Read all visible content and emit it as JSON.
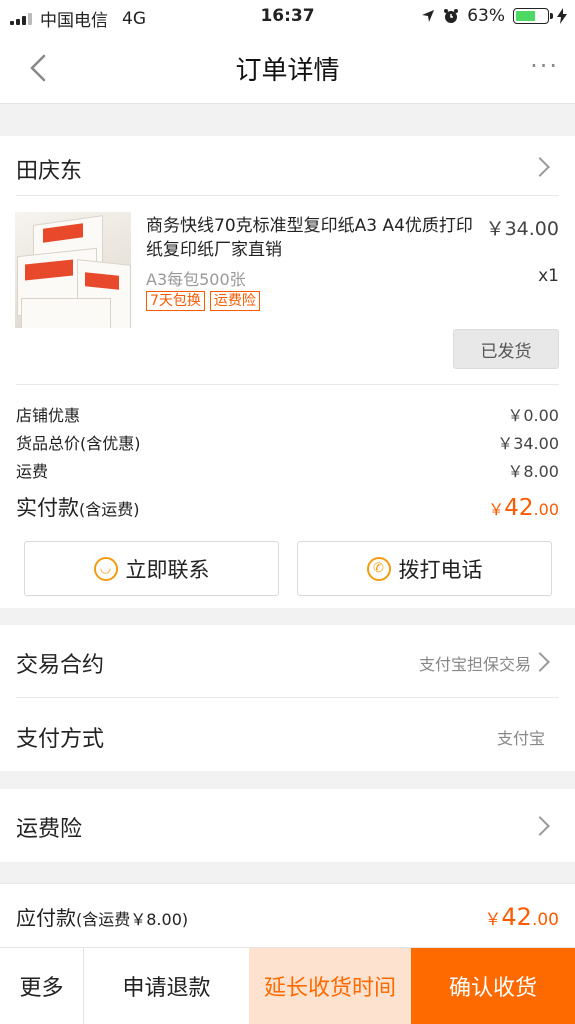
{
  "status_bar": {
    "carrier": "中国电信",
    "network": "4G",
    "time": "16:37",
    "battery": "63%",
    "battery_level": 0.63
  },
  "nav": {
    "title": "订单详情",
    "more": "···"
  },
  "shop": {
    "name": "田庆东"
  },
  "product": {
    "title": "商务快线70克标准型复印纸A3 A4优质打印纸复印纸厂家直销",
    "price": "￥34.00",
    "spec": "A3每包500张",
    "qty": "x1",
    "tags": [
      "7天包换",
      "运费险"
    ],
    "status_button": "已发货"
  },
  "fees": {
    "discount_label": "店铺优惠",
    "discount_value": "￥0.00",
    "goods_total_label": "货品总价(含优惠)",
    "goods_total_value": "￥34.00",
    "shipping_label": "运费",
    "shipping_value": "￥8.00",
    "paid_label": "实付款",
    "paid_note": "(含运费)",
    "paid_symbol": "￥",
    "paid_int": "42",
    "paid_dec": ".00"
  },
  "actions": {
    "contact": "立即联系",
    "call": "拨打电话"
  },
  "trade": {
    "contract_label": "交易合约",
    "contract_value": "支付宝担保交易",
    "payment_label": "支付方式",
    "payment_value": "支付宝",
    "insurance_label": "运费险"
  },
  "payable": {
    "label": "应付款",
    "note": "(含运费￥8.00)",
    "symbol": "￥",
    "int": "42",
    "dec": ".00"
  },
  "bottom_bar": {
    "more": "更多",
    "refund": "申请退款",
    "extend": "延长收货时间",
    "confirm": "确认收货"
  },
  "colors": {
    "accent": "#ff5a00",
    "confirm_bg": "#ff6a00",
    "extend_bg": "#fde3cf"
  }
}
